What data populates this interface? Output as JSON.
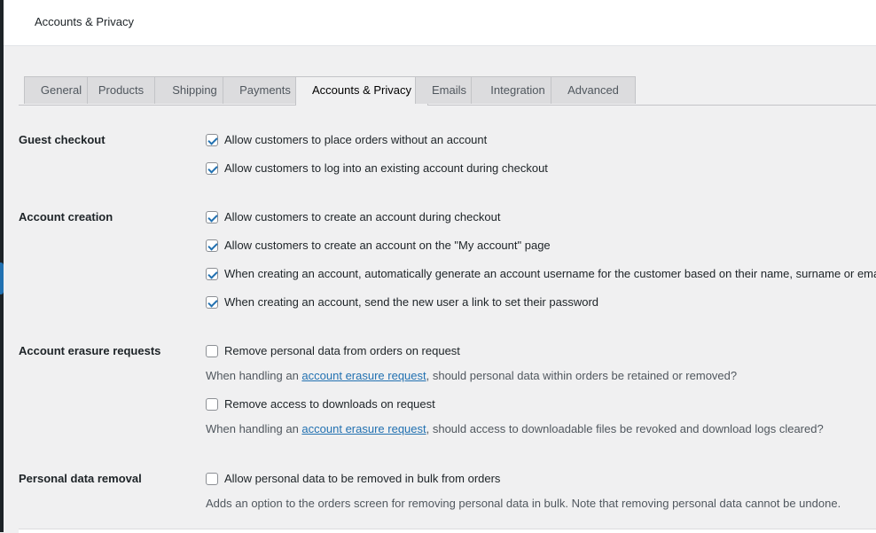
{
  "header": {
    "title": "Accounts & Privacy"
  },
  "tabs": [
    {
      "label": "General"
    },
    {
      "label": "Products"
    },
    {
      "label": "Shipping"
    },
    {
      "label": "Payments"
    },
    {
      "label": "Accounts & Privacy",
      "active": true
    },
    {
      "label": "Emails"
    },
    {
      "label": "Integration"
    },
    {
      "label": "Advanced"
    }
  ],
  "sections": {
    "guest_checkout": {
      "label": "Guest checkout",
      "options": [
        {
          "label": "Allow customers to place orders without an account",
          "checked": true
        },
        {
          "label": "Allow customers to log into an existing account during checkout",
          "checked": true
        }
      ]
    },
    "account_creation": {
      "label": "Account creation",
      "options": [
        {
          "label": "Allow customers to create an account during checkout",
          "checked": true
        },
        {
          "label": "Allow customers to create an account on the \"My account\" page",
          "checked": true
        },
        {
          "label": "When creating an account, automatically generate an account username for the customer based on their name, surname or email",
          "checked": true
        },
        {
          "label": "When creating an account, send the new user a link to set their password",
          "checked": true
        }
      ]
    },
    "erasure": {
      "label": "Account erasure requests",
      "options": [
        {
          "label": "Remove personal data from orders on request",
          "checked": false,
          "desc_before": "When handling an ",
          "desc_link": "account erasure request",
          "desc_after": ", should personal data within orders be retained or removed?"
        },
        {
          "label": "Remove access to downloads on request",
          "checked": false,
          "desc_before": "When handling an ",
          "desc_link": "account erasure request",
          "desc_after": ", should access to downloadable files be revoked and download logs cleared?"
        }
      ]
    },
    "removal": {
      "label": "Personal data removal",
      "options": [
        {
          "label": "Allow personal data to be removed in bulk from orders",
          "checked": false,
          "desc": "Adds an option to the orders screen for removing personal data in bulk. Note that removing personal data cannot be undone."
        }
      ]
    }
  },
  "colors": {
    "accent": "#2271b1",
    "background": "#f0f0f1",
    "tab_inactive": "#dcdcde"
  }
}
